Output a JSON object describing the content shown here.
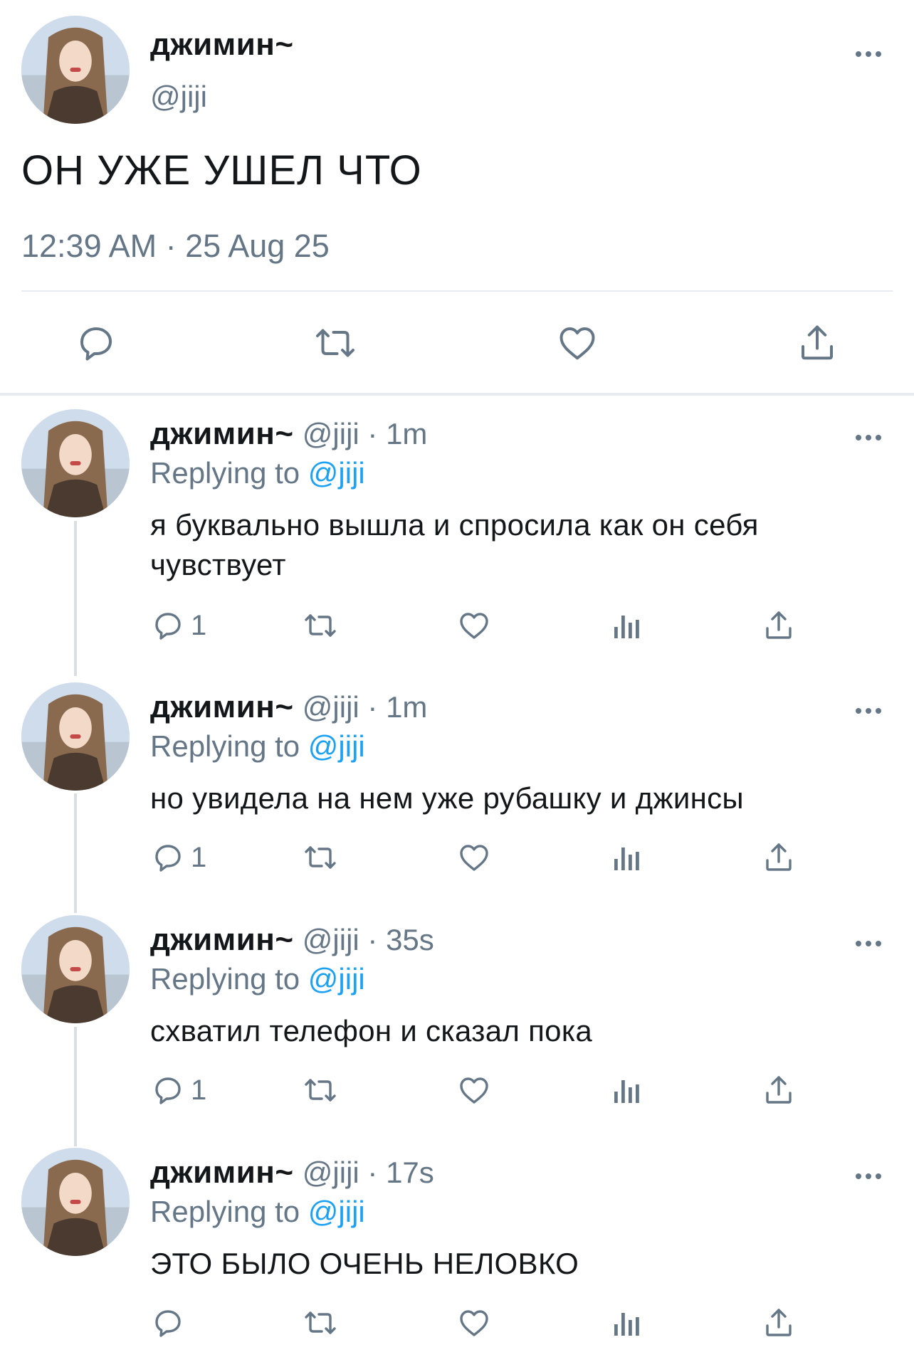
{
  "main_tweet": {
    "author_name": "джимин~",
    "author_handle": "@jiji",
    "text": "ОН УЖЕ УШЕЛ ЧТО",
    "timestamp": "12:39 AM · 25 Aug 25",
    "actions": [
      "reply-icon",
      "retweet-icon",
      "like-icon",
      "share-icon"
    ]
  },
  "replies": [
    {
      "author_name": "джимин~",
      "meta": "@jiji · 1m",
      "replying_prefix": "Replying to",
      "replying_mention": "@jiji",
      "text": "я буквально вышла и спросила как он себя чувствует",
      "reply_count": "1"
    },
    {
      "author_name": "джимин~",
      "meta": "@jiji · 1m",
      "replying_prefix": "Replying to",
      "replying_mention": "@jiji",
      "text": "но увидела на нем уже рубашку и джинсы",
      "reply_count": "1"
    },
    {
      "author_name": "джимин~",
      "meta": "@jiji · 35s",
      "replying_prefix": "Replying to",
      "replying_mention": "@jiji",
      "text": "схватил телефон и сказал пока",
      "reply_count": "1"
    },
    {
      "author_name": "джимин~",
      "meta": "@jiji · 17s",
      "replying_prefix": "Replying to",
      "replying_mention": "@jiji",
      "text": "ЭТО БЫЛО ОЧЕНЬ НЕЛОВКО",
      "reply_count": ""
    }
  ],
  "colors": {
    "text": "#14171a",
    "secondary": "#657786",
    "link": "#1da1f2",
    "divider": "#e6ecf0"
  }
}
